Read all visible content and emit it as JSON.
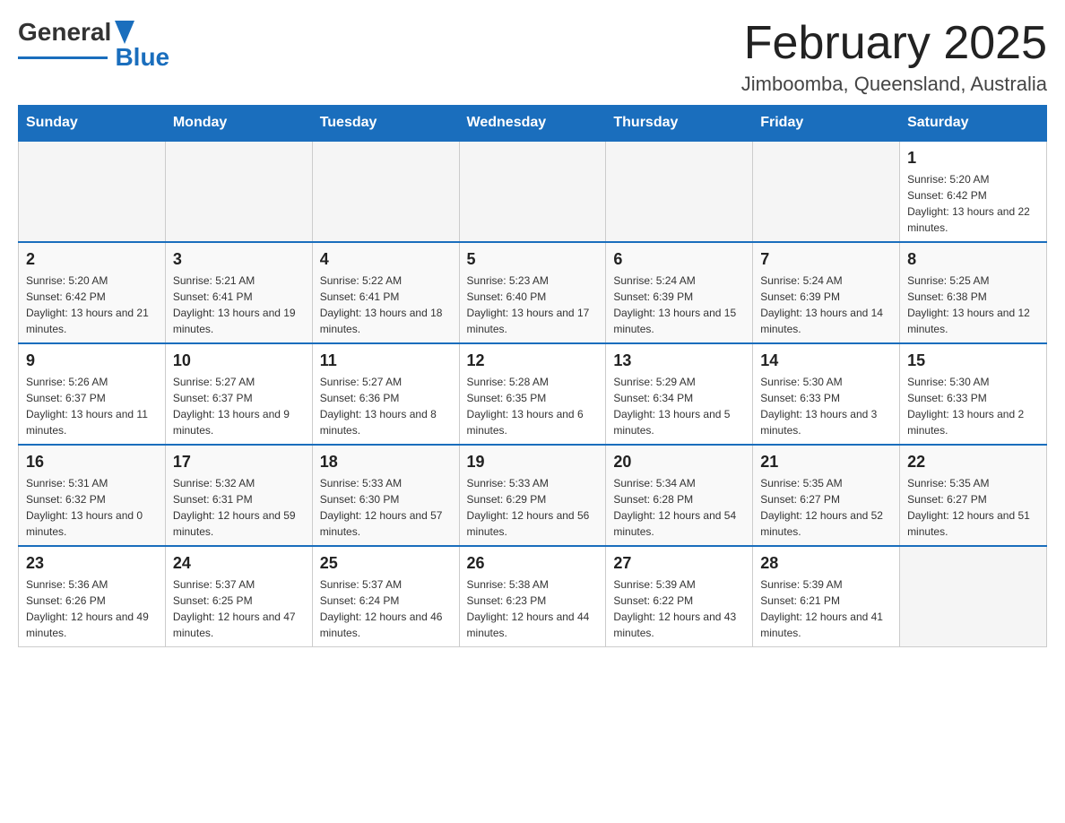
{
  "header": {
    "logo_general": "General",
    "logo_blue": "Blue",
    "title": "February 2025",
    "subtitle": "Jimboomba, Queensland, Australia"
  },
  "calendar": {
    "days_of_week": [
      "Sunday",
      "Monday",
      "Tuesday",
      "Wednesday",
      "Thursday",
      "Friday",
      "Saturday"
    ],
    "weeks": [
      [
        {
          "day": "",
          "info": ""
        },
        {
          "day": "",
          "info": ""
        },
        {
          "day": "",
          "info": ""
        },
        {
          "day": "",
          "info": ""
        },
        {
          "day": "",
          "info": ""
        },
        {
          "day": "",
          "info": ""
        },
        {
          "day": "1",
          "info": "Sunrise: 5:20 AM\nSunset: 6:42 PM\nDaylight: 13 hours and 22 minutes."
        }
      ],
      [
        {
          "day": "2",
          "info": "Sunrise: 5:20 AM\nSunset: 6:42 PM\nDaylight: 13 hours and 21 minutes."
        },
        {
          "day": "3",
          "info": "Sunrise: 5:21 AM\nSunset: 6:41 PM\nDaylight: 13 hours and 19 minutes."
        },
        {
          "day": "4",
          "info": "Sunrise: 5:22 AM\nSunset: 6:41 PM\nDaylight: 13 hours and 18 minutes."
        },
        {
          "day": "5",
          "info": "Sunrise: 5:23 AM\nSunset: 6:40 PM\nDaylight: 13 hours and 17 minutes."
        },
        {
          "day": "6",
          "info": "Sunrise: 5:24 AM\nSunset: 6:39 PM\nDaylight: 13 hours and 15 minutes."
        },
        {
          "day": "7",
          "info": "Sunrise: 5:24 AM\nSunset: 6:39 PM\nDaylight: 13 hours and 14 minutes."
        },
        {
          "day": "8",
          "info": "Sunrise: 5:25 AM\nSunset: 6:38 PM\nDaylight: 13 hours and 12 minutes."
        }
      ],
      [
        {
          "day": "9",
          "info": "Sunrise: 5:26 AM\nSunset: 6:37 PM\nDaylight: 13 hours and 11 minutes."
        },
        {
          "day": "10",
          "info": "Sunrise: 5:27 AM\nSunset: 6:37 PM\nDaylight: 13 hours and 9 minutes."
        },
        {
          "day": "11",
          "info": "Sunrise: 5:27 AM\nSunset: 6:36 PM\nDaylight: 13 hours and 8 minutes."
        },
        {
          "day": "12",
          "info": "Sunrise: 5:28 AM\nSunset: 6:35 PM\nDaylight: 13 hours and 6 minutes."
        },
        {
          "day": "13",
          "info": "Sunrise: 5:29 AM\nSunset: 6:34 PM\nDaylight: 13 hours and 5 minutes."
        },
        {
          "day": "14",
          "info": "Sunrise: 5:30 AM\nSunset: 6:33 PM\nDaylight: 13 hours and 3 minutes."
        },
        {
          "day": "15",
          "info": "Sunrise: 5:30 AM\nSunset: 6:33 PM\nDaylight: 13 hours and 2 minutes."
        }
      ],
      [
        {
          "day": "16",
          "info": "Sunrise: 5:31 AM\nSunset: 6:32 PM\nDaylight: 13 hours and 0 minutes."
        },
        {
          "day": "17",
          "info": "Sunrise: 5:32 AM\nSunset: 6:31 PM\nDaylight: 12 hours and 59 minutes."
        },
        {
          "day": "18",
          "info": "Sunrise: 5:33 AM\nSunset: 6:30 PM\nDaylight: 12 hours and 57 minutes."
        },
        {
          "day": "19",
          "info": "Sunrise: 5:33 AM\nSunset: 6:29 PM\nDaylight: 12 hours and 56 minutes."
        },
        {
          "day": "20",
          "info": "Sunrise: 5:34 AM\nSunset: 6:28 PM\nDaylight: 12 hours and 54 minutes."
        },
        {
          "day": "21",
          "info": "Sunrise: 5:35 AM\nSunset: 6:27 PM\nDaylight: 12 hours and 52 minutes."
        },
        {
          "day": "22",
          "info": "Sunrise: 5:35 AM\nSunset: 6:27 PM\nDaylight: 12 hours and 51 minutes."
        }
      ],
      [
        {
          "day": "23",
          "info": "Sunrise: 5:36 AM\nSunset: 6:26 PM\nDaylight: 12 hours and 49 minutes."
        },
        {
          "day": "24",
          "info": "Sunrise: 5:37 AM\nSunset: 6:25 PM\nDaylight: 12 hours and 47 minutes."
        },
        {
          "day": "25",
          "info": "Sunrise: 5:37 AM\nSunset: 6:24 PM\nDaylight: 12 hours and 46 minutes."
        },
        {
          "day": "26",
          "info": "Sunrise: 5:38 AM\nSunset: 6:23 PM\nDaylight: 12 hours and 44 minutes."
        },
        {
          "day": "27",
          "info": "Sunrise: 5:39 AM\nSunset: 6:22 PM\nDaylight: 12 hours and 43 minutes."
        },
        {
          "day": "28",
          "info": "Sunrise: 5:39 AM\nSunset: 6:21 PM\nDaylight: 12 hours and 41 minutes."
        },
        {
          "day": "",
          "info": ""
        }
      ]
    ]
  }
}
